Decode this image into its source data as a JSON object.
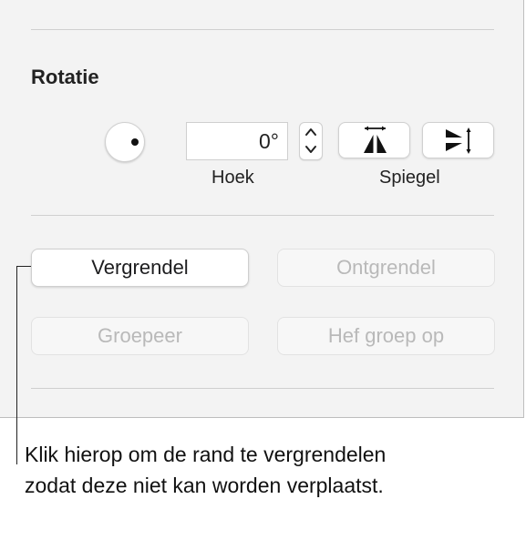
{
  "rotation": {
    "section_title": "Rotatie",
    "angle_value": "0°",
    "angle_caption": "Hoek",
    "flip_caption": "Spiegel",
    "icons": {
      "dial": "rotation-dial-icon",
      "stepper_up": "chevron-up-icon",
      "stepper_down": "chevron-down-icon",
      "flip_horizontal": "flip-horizontal-icon",
      "flip_vertical": "flip-vertical-icon"
    }
  },
  "arrange": {
    "lock_label": "Vergrendel",
    "unlock_label": "Ontgrendel",
    "group_label": "Groepeer",
    "ungroup_label": "Hef groep op"
  },
  "callout": {
    "text": "Klik hierop om de rand te vergrendelen zodat deze niet kan worden verplaatst."
  }
}
